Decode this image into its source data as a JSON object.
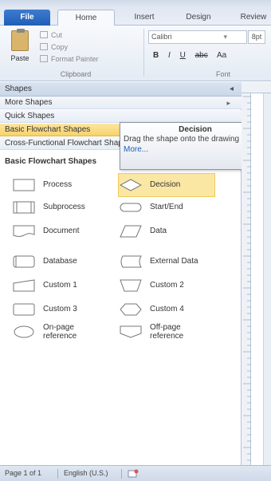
{
  "tabs": {
    "file": "File",
    "home": "Home",
    "insert": "Insert",
    "design": "Design",
    "review": "Review"
  },
  "ribbon": {
    "paste": "Paste",
    "cut": "Cut",
    "copy": "Copy",
    "format_painter": "Format Painter",
    "clipboard_group": "Clipboard",
    "font_name": "Calibri",
    "font_size": "8pt",
    "bold": "B",
    "italic": "I",
    "underline": "U",
    "strikethrough": "abc",
    "change_case": "Aa",
    "font_group": "Font"
  },
  "pane": {
    "header": "Shapes",
    "more_shapes": "More Shapes",
    "quick_shapes": "Quick Shapes",
    "basic_flowchart": "Basic Flowchart Shapes",
    "cross_functional": "Cross-Functional Flowchart Shapes",
    "stencil_title": "Basic Flowchart Shapes"
  },
  "shapes": {
    "process": "Process",
    "decision": "Decision",
    "subprocess": "Subprocess",
    "start_end": "Start/End",
    "document": "Document",
    "data": "Data",
    "database": "Database",
    "external_data": "External Data",
    "custom1": "Custom 1",
    "custom2": "Custom 2",
    "custom3": "Custom 3",
    "custom4": "Custom 4",
    "on_page_line1": "On-page",
    "on_page_line2": "reference",
    "off_page_line1": "Off-page",
    "off_page_line2": "reference"
  },
  "tooltip": {
    "title": "Decision",
    "body": "Drag the shape onto the drawing page.",
    "more": "More..."
  },
  "status": {
    "page": "Page 1 of 1",
    "language": "English (U.S.)"
  }
}
